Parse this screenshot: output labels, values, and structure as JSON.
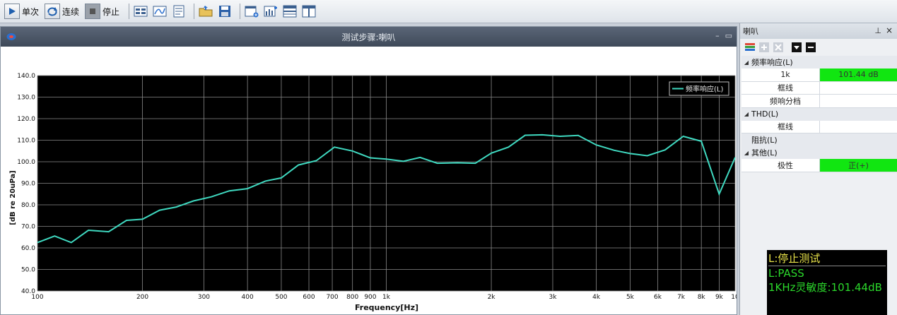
{
  "toolbar": {
    "single_label": "单次",
    "continuous_label": "连续",
    "stop_label": "停止"
  },
  "window": {
    "title": "测试步骤:喇叭"
  },
  "side_panel": {
    "title": "喇叭",
    "groups": [
      {
        "label": "频率响应(L)",
        "rows": [
          {
            "key": "1k",
            "value": "101.44 dB",
            "highlight": true
          },
          {
            "key": "框线",
            "value": "",
            "highlight": false
          },
          {
            "key": "频响分档",
            "value": "",
            "highlight": false
          }
        ]
      },
      {
        "label": "THD(L)",
        "rows": [
          {
            "key": "框线",
            "value": "",
            "highlight": false
          }
        ]
      },
      {
        "label": "阻抗(L)",
        "rows": []
      },
      {
        "label": "其他(L)",
        "rows": [
          {
            "key": "极性",
            "value": "正(+)",
            "highlight": true
          }
        ]
      }
    ]
  },
  "status": {
    "line1": "L:停止测试",
    "line2": "L:PASS",
    "line3": "1KHz灵敏度:101.44dB"
  },
  "colors": {
    "plot_bg": "#000000",
    "curve": "#3fd9c0",
    "pass_green": "#11e611"
  },
  "chart_data": {
    "type": "line",
    "x_scale": "log",
    "xlabel": "Frequency[Hz]",
    "ylabel": "[dB re 20uPa]",
    "xlim": [
      100,
      10000
    ],
    "ylim": [
      40,
      140
    ],
    "x_ticks": [
      100,
      200,
      300,
      400,
      500,
      600,
      700,
      800,
      900,
      1000,
      2000,
      3000,
      4000,
      5000,
      6000,
      7000,
      8000,
      9000,
      10000
    ],
    "x_tick_labels": [
      "100",
      "200",
      "300",
      "400",
      "500",
      "600",
      "700",
      "800",
      "900",
      "1k",
      "2k",
      "3k",
      "4k",
      "5k",
      "6k",
      "7k",
      "8k",
      "9k",
      "10"
    ],
    "y_ticks": [
      40,
      50,
      60,
      70,
      80,
      90,
      100,
      110,
      120,
      130,
      140
    ],
    "y_tick_labels": [
      "40.0",
      "50.0",
      "60.0",
      "70.0",
      "80.0",
      "90.0",
      "100.0",
      "110.0",
      "120.0",
      "130.0",
      "140.0"
    ],
    "legend": "top-right",
    "grid": true,
    "series": [
      {
        "name": "频率响应(L)",
        "x": [
          100,
          112,
          125,
          140,
          160,
          180,
          200,
          224,
          250,
          280,
          315,
          355,
          400,
          450,
          500,
          560,
          630,
          710,
          800,
          900,
          1000,
          1120,
          1250,
          1400,
          1600,
          1800,
          2000,
          2240,
          2500,
          2800,
          3150,
          3550,
          4000,
          4500,
          5000,
          5600,
          6300,
          7100,
          8000,
          9000,
          10000
        ],
        "y": [
          62.5,
          65.5,
          62.5,
          68.2,
          67.5,
          72.8,
          73.3,
          77.5,
          79.0,
          81.8,
          83.7,
          86.5,
          87.5,
          91.0,
          92.5,
          98.5,
          100.5,
          106.8,
          105.0,
          101.8,
          101.2,
          100.2,
          102.0,
          99.3,
          99.5,
          99.3,
          104.0,
          106.8,
          112.3,
          112.5,
          111.8,
          112.2,
          107.8,
          105.3,
          103.8,
          102.8,
          105.5,
          111.8,
          109.5,
          85.0,
          102.0
        ]
      }
    ]
  }
}
